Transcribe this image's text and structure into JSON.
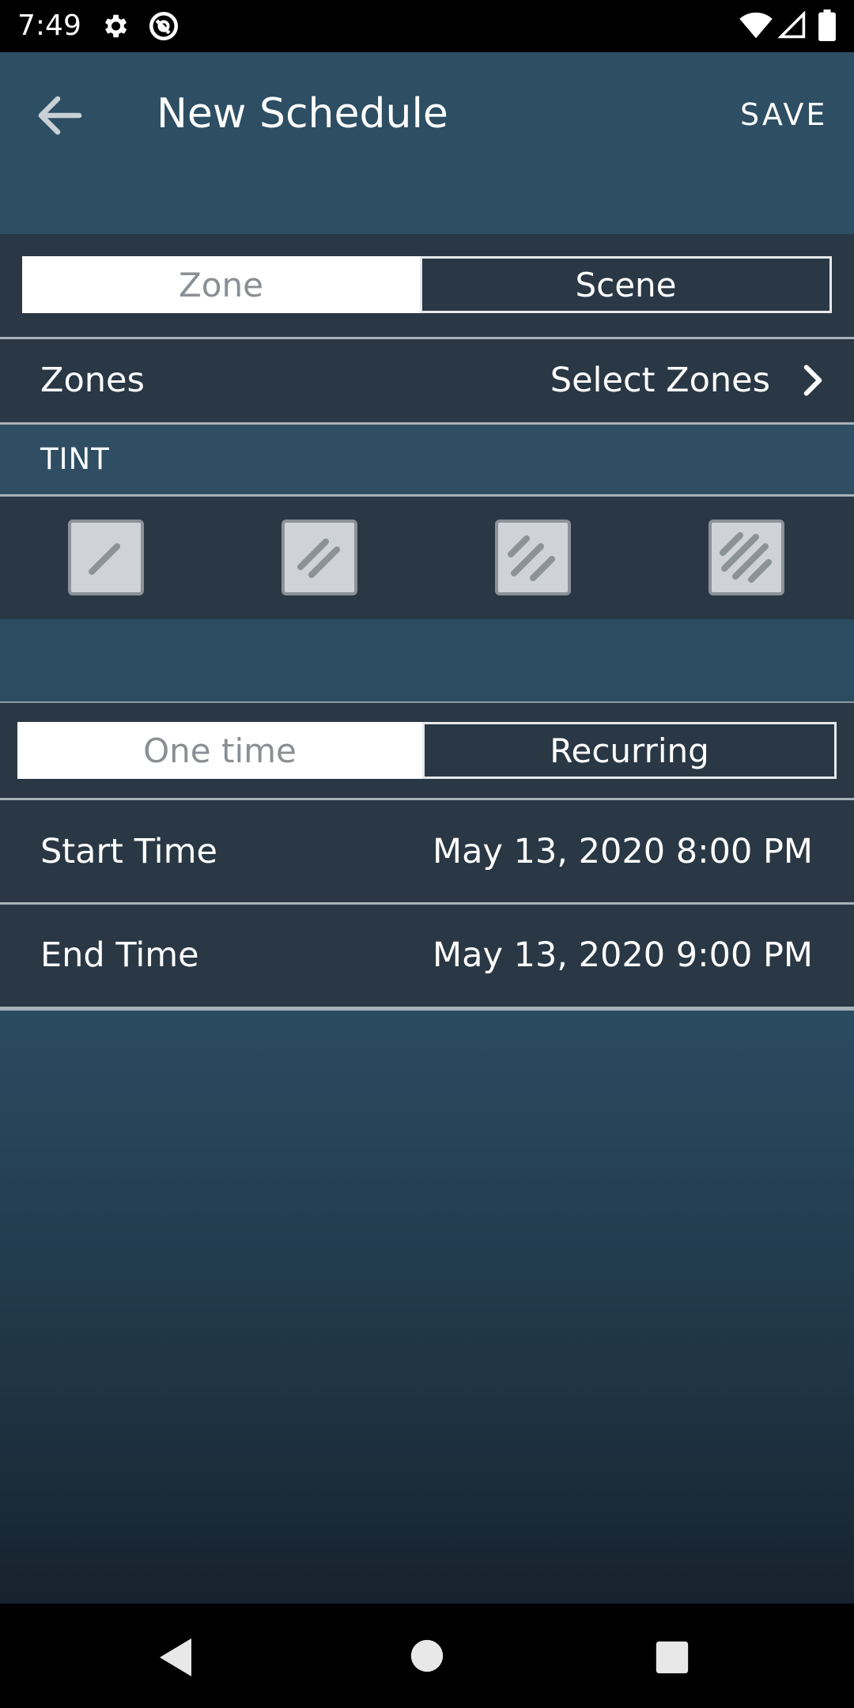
{
  "status_bar": {
    "time": "7:49",
    "icons": [
      "settings-gear-icon",
      "sync-circle-icon",
      "wifi-icon",
      "cell-signal-icon",
      "battery-icon"
    ]
  },
  "app_bar": {
    "title": "New Schedule",
    "save_label": "SAVE",
    "back_icon": "arrow-left-icon"
  },
  "target_toggle": {
    "options": [
      "Zone",
      "Scene"
    ],
    "selected": "Scene"
  },
  "zones_row": {
    "label": "Zones",
    "value": "Select Zones",
    "icon": "chevron-right-icon"
  },
  "tint": {
    "header": "TINT",
    "levels": [
      {
        "icon": "tint-level-1-icon",
        "stripes": 1
      },
      {
        "icon": "tint-level-2-icon",
        "stripes": 2
      },
      {
        "icon": "tint-level-3-icon",
        "stripes": 3
      },
      {
        "icon": "tint-level-4-icon",
        "stripes": 4
      }
    ]
  },
  "frequency_toggle": {
    "options": [
      "One time",
      "Recurring"
    ],
    "selected": "Recurring"
  },
  "start_time": {
    "label": "Start Time",
    "value": "May 13, 2020 8:00 PM"
  },
  "end_time": {
    "label": "End Time",
    "value": "May 13, 2020 9:00 PM"
  },
  "nav_bar": {
    "icons": [
      "back-triangle-icon",
      "home-circle-icon",
      "recents-square-icon"
    ]
  },
  "colors": {
    "app_bar": "#2d4e63",
    "panel": "#2a3845",
    "status_bar": "#000000",
    "segment_selected_bg": "#ffffff",
    "segment_unselected_text": "#8a8f94"
  }
}
